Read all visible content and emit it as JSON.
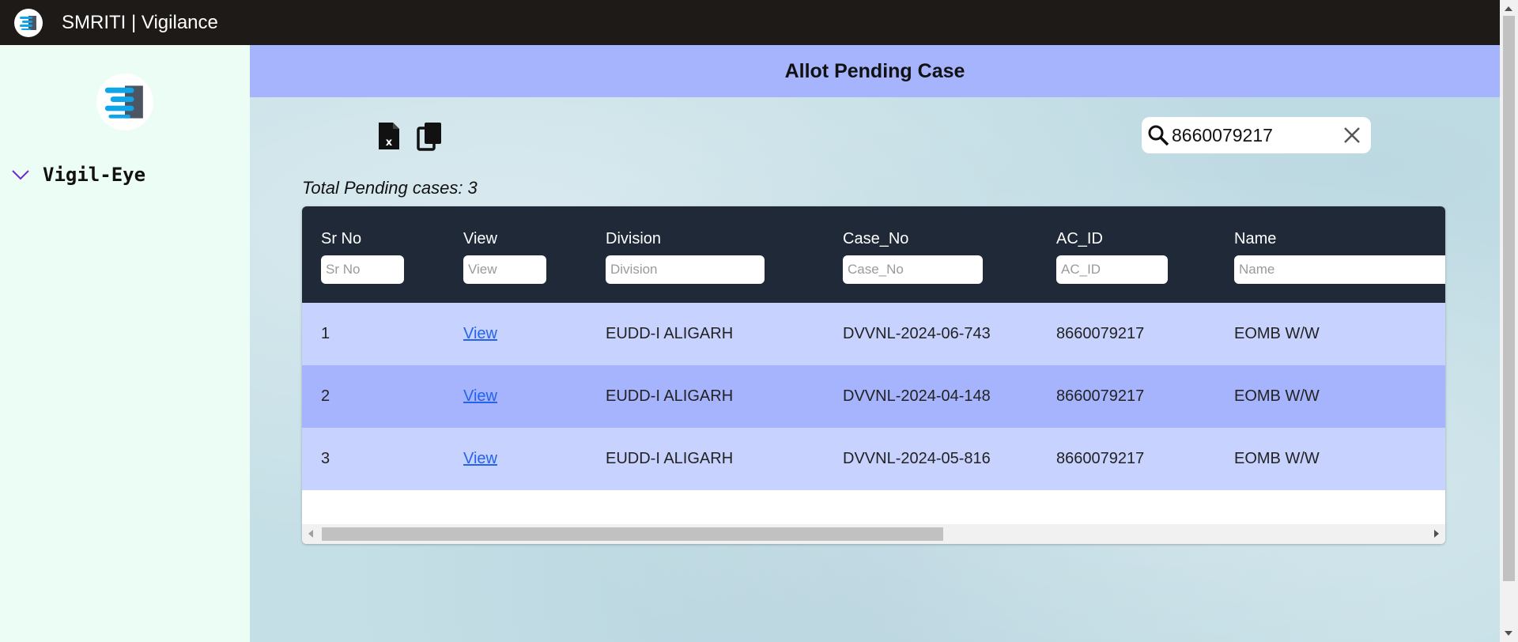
{
  "app": {
    "title": "SMRITI | Vigilance"
  },
  "sidebar": {
    "items": [
      {
        "label": "Vigil-Eye",
        "expanded": true
      }
    ]
  },
  "main": {
    "title": "Allot Pending Case",
    "toolbar": {
      "icons": [
        "excel-export-icon",
        "copy-icon"
      ]
    },
    "search": {
      "value": "8660079217"
    },
    "total_label": "Total Pending cases: 3",
    "table": {
      "columns": [
        {
          "label": "Sr No",
          "placeholder": "Sr No"
        },
        {
          "label": "View",
          "placeholder": "View"
        },
        {
          "label": "Division",
          "placeholder": "Division"
        },
        {
          "label": "Case_No",
          "placeholder": "Case_No"
        },
        {
          "label": "AC_ID",
          "placeholder": "AC_ID"
        },
        {
          "label": "Name",
          "placeholder": "Name"
        }
      ],
      "rows": [
        {
          "sr_no": "1",
          "view": "View",
          "division": "EUDD-I ALIGARH",
          "case_no": "DVVNL-2024-06-743",
          "ac_id": "8660079217",
          "name": "EOMB W/W"
        },
        {
          "sr_no": "2",
          "view": "View",
          "division": "EUDD-I ALIGARH",
          "case_no": "DVVNL-2024-04-148",
          "ac_id": "8660079217",
          "name": "EOMB W/W"
        },
        {
          "sr_no": "3",
          "view": "View",
          "division": "EUDD-I ALIGARH",
          "case_no": "DVVNL-2024-05-816",
          "ac_id": "8660079217",
          "name": "EOMB W/W"
        }
      ]
    }
  },
  "colors": {
    "topbar": "#1e1a17",
    "sidebar_bg": "#ebfdf5",
    "header_band": "#a5b4fc",
    "table_header": "#1f2937",
    "row_light": "#c7d2fe",
    "row_dark": "#a5b4fc",
    "link": "#2563eb"
  }
}
